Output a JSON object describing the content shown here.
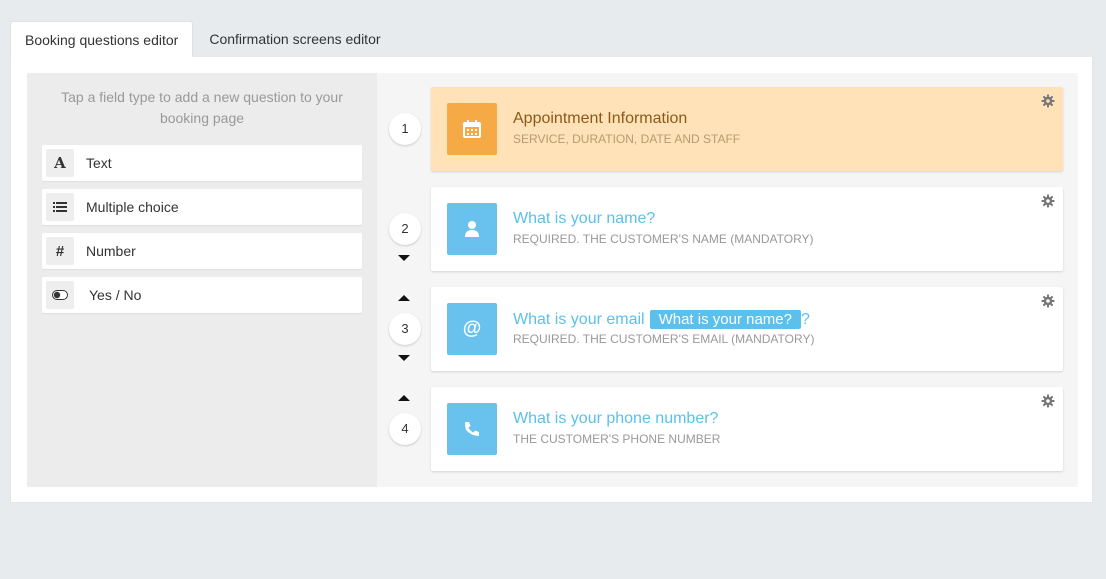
{
  "tabs": [
    {
      "label": "Booking questions editor",
      "active": true
    },
    {
      "label": "Confirmation screens editor",
      "active": false
    }
  ],
  "sidebar": {
    "hint": "Tap a field type to add a new question to your booking page",
    "field_types": [
      {
        "label": "Text",
        "icon": "text-format-icon"
      },
      {
        "label": "Multiple choice",
        "icon": "list-icon"
      },
      {
        "label": "Number",
        "icon": "hash-icon"
      },
      {
        "label": "Yes / No",
        "icon": "toggle-icon"
      }
    ]
  },
  "questions": [
    {
      "number": "1",
      "title": "Appointment Information",
      "subtitle": "SERVICE, DURATION, DATE AND STAFF",
      "icon": "calendar-icon"
    },
    {
      "number": "2",
      "title": "What is your name?",
      "subtitle": "REQUIRED. THE CUSTOMER'S NAME (MANDATORY)",
      "icon": "user-icon"
    },
    {
      "number": "3",
      "title_prefix": "What is your email",
      "title_chip": "What is your name?",
      "title_suffix": "?",
      "subtitle": "REQUIRED. THE CUSTOMER'S EMAIL (MANDATORY)",
      "icon": "at-sign-icon"
    },
    {
      "number": "4",
      "title": "What is your phone number?",
      "subtitle": "THE CUSTOMER'S PHONE NUMBER",
      "icon": "phone-icon"
    }
  ],
  "colors": {
    "accent": "#5bc0eb",
    "appointment_bg": "#ffe2b7",
    "appointment_icon": "#f6aa46"
  }
}
